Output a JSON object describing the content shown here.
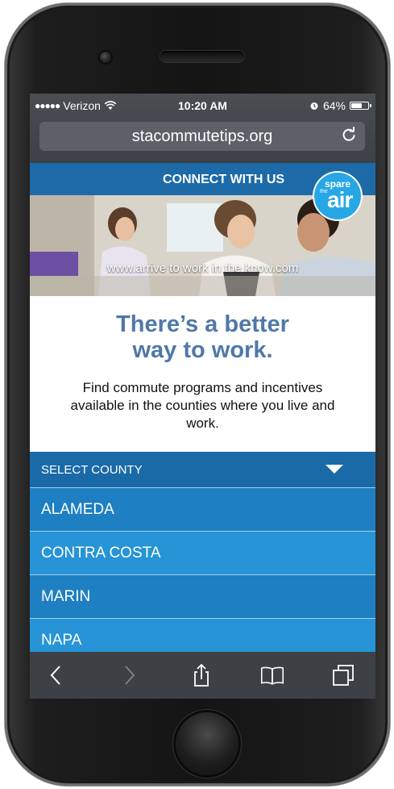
{
  "status_bar": {
    "carrier": "Verizon",
    "signal_dots": "●●●●●",
    "time": "10:20 AM",
    "battery_percent": "64%",
    "battery_level": 0.64
  },
  "browser": {
    "url": "stacommutetips.org"
  },
  "site": {
    "connect_label": "CONNECT WITH US",
    "hero_url": "www.arrive to work in the know.com",
    "logo": {
      "spare": "spare",
      "the": "the",
      "air": "air"
    },
    "headline_line1": "There’s a better",
    "headline_line2": "way to work.",
    "description": "Find commute programs and incentives available in the counties where you live and work.",
    "select_county_label": "SELECT COUNTY",
    "counties": [
      "ALAMEDA",
      "CONTRA COSTA",
      "MARIN",
      "NAPA"
    ]
  },
  "colors": {
    "brand_blue": "#1d6aa8",
    "headline_blue": "#4f78a8",
    "list_blue_dark": "#1e7fc2",
    "list_blue_light": "#2694d6",
    "logo_blue": "#27a7e6"
  },
  "icons": [
    "wifi-icon",
    "alarm-icon",
    "battery-icon",
    "reload-icon",
    "back-icon",
    "forward-icon",
    "share-icon",
    "bookmarks-icon",
    "tabs-icon",
    "dropdown-arrow-icon"
  ]
}
